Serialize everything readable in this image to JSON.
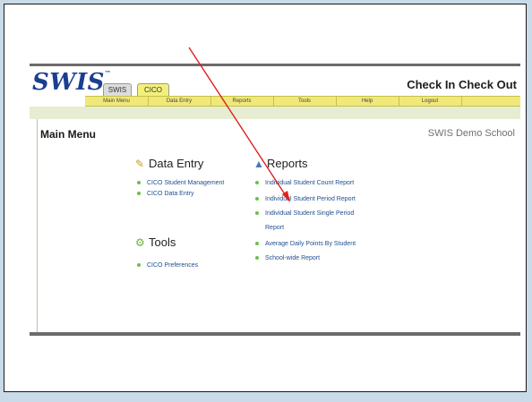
{
  "app": {
    "logo": "SWIS",
    "logo_tm": "™",
    "tabs": [
      {
        "label": "SWIS"
      },
      {
        "label": "CICO"
      }
    ],
    "title": "Check In Check Out"
  },
  "menu": {
    "items": [
      {
        "label": "Main Menu"
      },
      {
        "label": "Data Entry"
      },
      {
        "label": "Reports"
      },
      {
        "label": "Tools"
      },
      {
        "label": "Help"
      },
      {
        "label": "Logout"
      }
    ]
  },
  "page": {
    "title": "Main Menu",
    "school": "SWIS Demo School"
  },
  "data_entry": {
    "heading": "Data Entry",
    "icon": "pencil-icon",
    "links": [
      {
        "label": "CICO Student Management"
      },
      {
        "label": "CICO Data Entry"
      }
    ]
  },
  "tools": {
    "heading": "Tools",
    "icon": "gear-icon",
    "links": [
      {
        "label": "CICO Preferences"
      }
    ]
  },
  "reports": {
    "heading": "Reports",
    "icon": "chart-icon",
    "links": [
      {
        "label": "Individual Student Count Report"
      },
      {
        "label": "Individual Student Period Report"
      },
      {
        "label": "Individual Student Single Period"
      },
      {
        "label": "Report"
      },
      {
        "label": "Average Daily Points By Student"
      },
      {
        "label": "School-wide Report"
      }
    ]
  },
  "colors": {
    "accent": "#f0e97a",
    "link": "#1f4e8f",
    "bullet": "#6cbf4a",
    "annotation_arrow": "#e02020",
    "background": "#c9dbe8"
  }
}
